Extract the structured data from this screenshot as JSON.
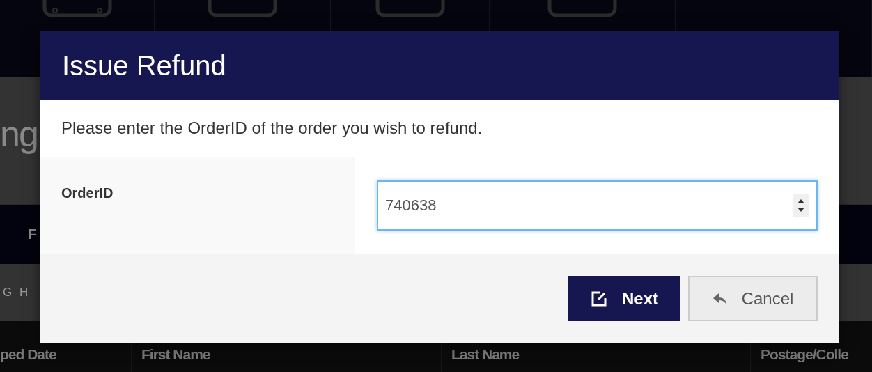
{
  "background_page": {
    "heading": "ng",
    "tab_bar": {
      "label": "F"
    },
    "filter_label": "G H",
    "table": {
      "columns": [
        "ped Date",
        "First Name",
        "Last Name",
        "Postage/Colle"
      ]
    }
  },
  "dialog": {
    "title": "Issue Refund",
    "message": "Please enter the OrderID of the order you wish to refund.",
    "field": {
      "label": "OrderID",
      "value": "740638",
      "focused": true
    },
    "buttons": [
      {
        "kind": "primary",
        "label": "Next"
      },
      {
        "kind": "secondary",
        "label": "Cancel"
      }
    ]
  }
}
